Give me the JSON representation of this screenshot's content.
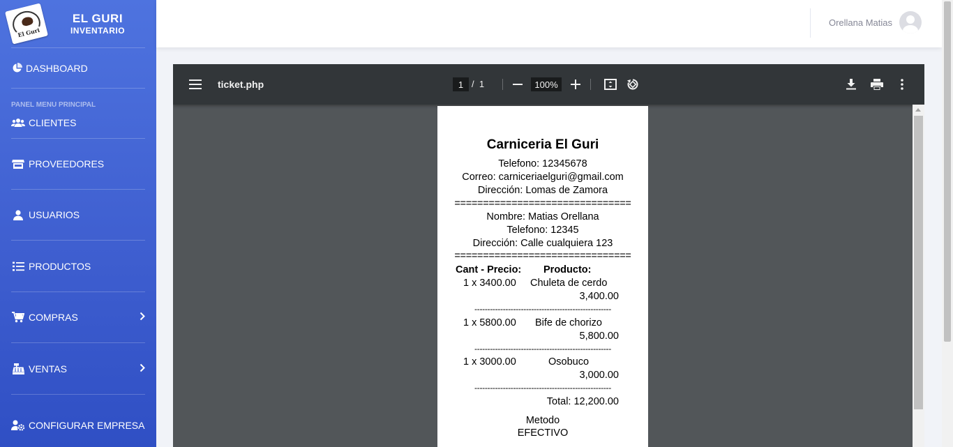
{
  "brand": {
    "logo_text": "El Guri",
    "title": "EL GURI",
    "subtitle": "INVENTARIO"
  },
  "sidebar": {
    "dashboard": "DASHBOARD",
    "section": "PANEL MENU PRINCIPAL",
    "items": [
      {
        "label": "CLIENTES",
        "icon": "users-icon"
      },
      {
        "label": "PROVEEDORES",
        "icon": "store-icon"
      },
      {
        "label": "USUARIOS",
        "icon": "user-icon"
      },
      {
        "label": "PRODUCTOS",
        "icon": "list-icon"
      },
      {
        "label": "COMPRAS",
        "icon": "cart-icon",
        "has_submenu": true
      },
      {
        "label": "VENTAS",
        "icon": "cash-register-icon",
        "has_submenu": true
      },
      {
        "label": "CONFIGURAR EMPRESA",
        "icon": "user-cog-icon"
      }
    ]
  },
  "topbar": {
    "user_name": "Orellana Matias"
  },
  "viewer": {
    "filename": "ticket.php",
    "current_page": "1",
    "page_sep": "/",
    "total_pages": "1",
    "zoom": "100%"
  },
  "ticket": {
    "store_name": "Carniceria El Guri",
    "phone": "Telefono: 12345678",
    "email": "Correo: carniceriaelguri@gmail.com",
    "address": "Dirección: Lomas de Zamora",
    "separator": "===============================",
    "customer_name": "Nombre: Matias Orellana",
    "customer_phone": "Telefono: 12345",
    "customer_address": "Dirección: Calle cualquiera 123",
    "header_qty_price": "Cant - Precio:",
    "header_product": "Producto:",
    "dash_line": "-----------------------------------------------------",
    "items": [
      {
        "qty_price": "1 x 3400.00",
        "product": "Chuleta de cerdo",
        "subtotal": "3,400.00"
      },
      {
        "qty_price": "1 x 5800.00",
        "product": "Bife de chorizo",
        "subtotal": "5,800.00"
      },
      {
        "qty_price": "1 x 3000.00",
        "product": "Osobuco",
        "subtotal": "3,000.00"
      }
    ],
    "total": "Total: 12,200.00",
    "method_label": "Metodo",
    "method_value": "EFECTIVO"
  },
  "colors": {
    "sidebar_top": "#4e73df",
    "sidebar_bottom": "#2f4fc4",
    "viewer_bg": "#525659",
    "viewer_toolbar": "#323639"
  }
}
